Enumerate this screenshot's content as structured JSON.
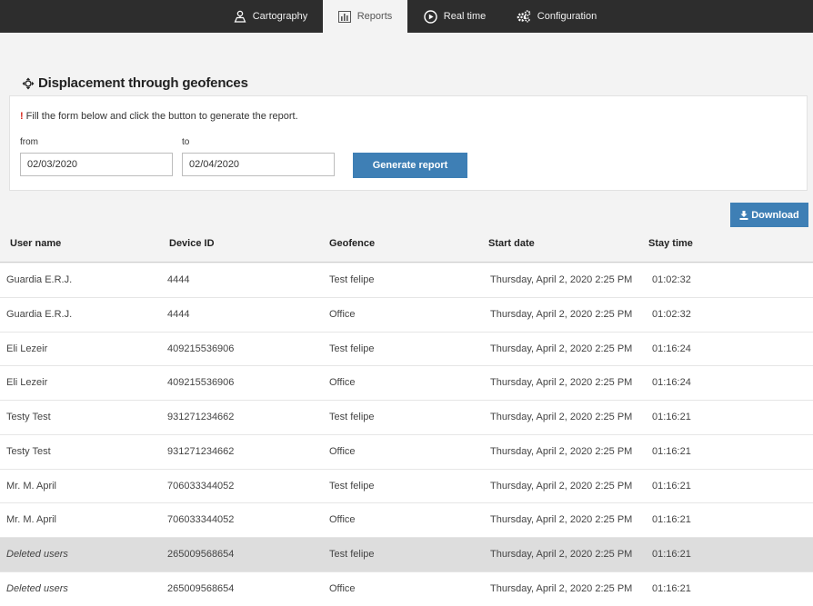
{
  "nav": {
    "tabs": [
      {
        "label": "Cartography",
        "icon": "map-person-icon"
      },
      {
        "label": "Reports",
        "icon": "bar-chart-icon"
      },
      {
        "label": "Real time",
        "icon": "play-circle-icon"
      },
      {
        "label": "Configuration",
        "icon": "gears-icon"
      }
    ],
    "active": "Reports"
  },
  "page": {
    "title": "Displacement through geofences",
    "title_icon": "move-arrows-icon"
  },
  "form": {
    "notice_mark": "!",
    "notice": "Fill the form below and click the button to generate the report.",
    "from_label": "from",
    "from_value": "02/03/2020",
    "to_label": "to",
    "to_value": "02/04/2020",
    "generate_label": "Generate report"
  },
  "download_label": "Download",
  "table": {
    "headers": [
      "User name",
      "Device ID",
      "Geofence",
      "Start date",
      "Stay time"
    ],
    "rows": [
      {
        "user": "Guardia E.R.J.",
        "device": "4444",
        "geofence": "Test felipe",
        "start": "Thursday, April 2, 2020 2:25 PM",
        "stay": "01:02:32"
      },
      {
        "user": "Guardia E.R.J.",
        "device": "4444",
        "geofence": "Office",
        "start": "Thursday, April 2, 2020 2:25 PM",
        "stay": "01:02:32"
      },
      {
        "user": "Eli Lezeir",
        "device": "409215536906",
        "geofence": "Test felipe",
        "start": "Thursday, April 2, 2020 2:25 PM",
        "stay": "01:16:24"
      },
      {
        "user": "Eli Lezeir",
        "device": "409215536906",
        "geofence": "Office",
        "start": "Thursday, April 2, 2020 2:25 PM",
        "stay": "01:16:24"
      },
      {
        "user": "Testy Test",
        "device": "931271234662",
        "geofence": "Test felipe",
        "start": "Thursday, April 2, 2020 2:25 PM",
        "stay": "01:16:21"
      },
      {
        "user": "Testy Test",
        "device": "931271234662",
        "geofence": "Office",
        "start": "Thursday, April 2, 2020 2:25 PM",
        "stay": "01:16:21"
      },
      {
        "user": "Mr. M. April",
        "device": "706033344052",
        "geofence": "Test felipe",
        "start": "Thursday, April 2, 2020 2:25 PM",
        "stay": "01:16:21"
      },
      {
        "user": "Mr. M. April",
        "device": "706033344052",
        "geofence": "Office",
        "start": "Thursday, April 2, 2020 2:25 PM",
        "stay": "01:16:21"
      },
      {
        "user": "Deleted users",
        "device": "265009568654",
        "geofence": "Test felipe",
        "start": "Thursday, April 2, 2020 2:25 PM",
        "stay": "01:16:21",
        "highlighted": true,
        "deleted": true
      },
      {
        "user": "Deleted users",
        "device": "265009568654",
        "geofence": "Office",
        "start": "Thursday, April 2, 2020 2:25 PM",
        "stay": "01:16:21",
        "deleted": true
      }
    ]
  },
  "colors": {
    "accent": "#3e7fb5",
    "topbar": "#2d2d2d",
    "alert": "#d9261c",
    "row_highlight": "#dddddd"
  }
}
